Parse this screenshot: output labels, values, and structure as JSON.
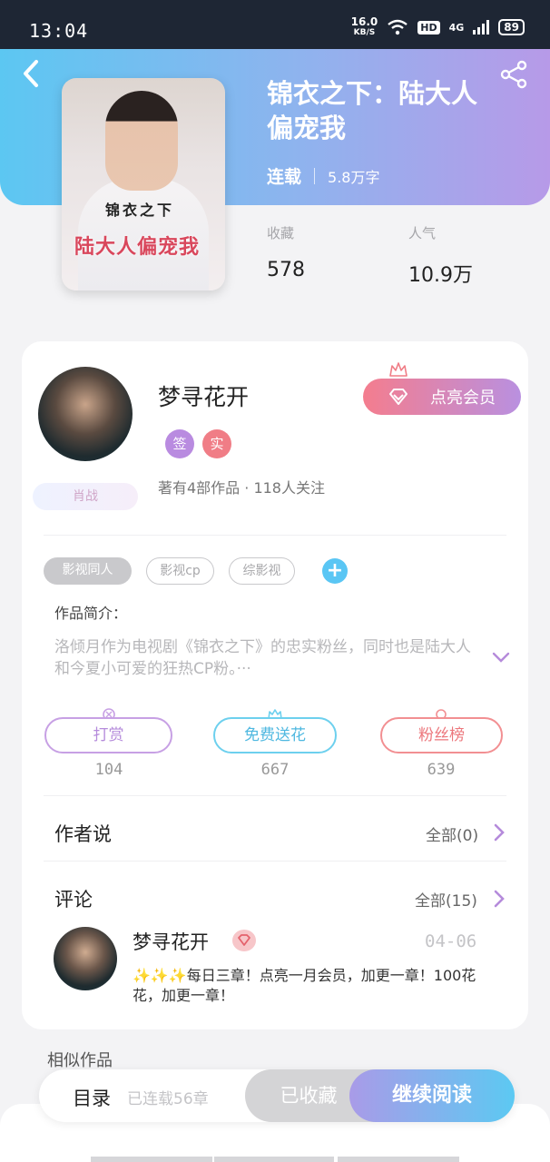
{
  "status_bar": {
    "time": "13:04",
    "net_speed": "16.0",
    "net_unit": "KB/S",
    "hd": "HD",
    "signal": "4G",
    "battery": "89"
  },
  "book": {
    "title": "锦衣之下：陆大人偏宠我",
    "status": "连载",
    "words": "5.8万字",
    "cover_title_line1": "锦衣之下",
    "cover_title_line2": "陆大人偏宠我",
    "stats": [
      {
        "label": "收藏",
        "value": "578"
      },
      {
        "label": "人气",
        "value": "10.9万"
      }
    ]
  },
  "author": {
    "name": "梦寻花开",
    "badges": [
      "签",
      "实"
    ],
    "avatar_tag": "肖战",
    "vip_button": "点亮会员",
    "stats_text": "著有4部作品 · 118人关注"
  },
  "tags": [
    "影视同人",
    "影视cp",
    "综影视"
  ],
  "intro": {
    "label": "作品简介：",
    "text": "洛倾月作为电视剧《锦衣之下》的忠实粉丝，同时也是陆大人和今夏小可爱的狂热CP粉。···"
  },
  "actions": [
    {
      "label": "打赏",
      "count": "104"
    },
    {
      "label": "免费送花",
      "count": "667"
    },
    {
      "label": "粉丝榜",
      "count": "639"
    }
  ],
  "author_says": {
    "title": "作者说",
    "link": "全部(0)"
  },
  "comments": {
    "title": "评论",
    "link": "全部(15)",
    "items": [
      {
        "name": "梦寻花开",
        "date": "04-06",
        "text": "✨✨✨每日三章！点亮一月会员，加更一章！100花花，加更一章！"
      }
    ]
  },
  "similar_title": "相似作品",
  "bottom": {
    "toc": "目录",
    "toc_status": "已连载56章",
    "collected": "已收藏",
    "read": "继续阅读"
  },
  "colors": {
    "hero_start": "#5cc7f2",
    "hero_end": "#b79ae8",
    "vip_start": "#f47d8e",
    "vip_end": "#b990e0",
    "chevron": "#b58bdb"
  },
  "icons": {
    "back": "chevron-left-icon",
    "share": "share-icon",
    "expand": "chevron-down-icon",
    "more": "chevron-right-icon",
    "vip": "diamond-icon"
  }
}
